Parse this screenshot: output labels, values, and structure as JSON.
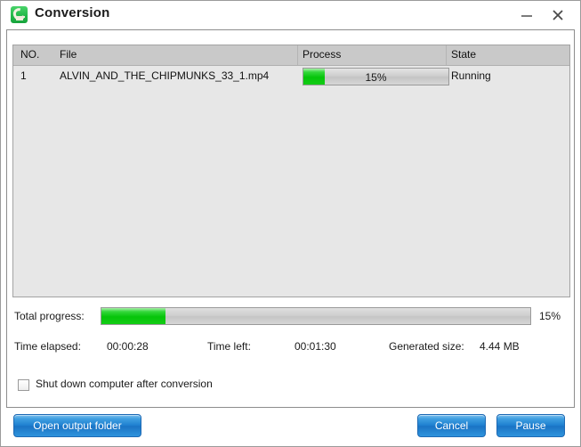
{
  "window": {
    "title": "Conversion",
    "icon": "app-logo-icon",
    "minimize_label": "minimize-icon",
    "close_label": "close-icon"
  },
  "list": {
    "columns": [
      "NO.",
      "File",
      "Process",
      "State"
    ],
    "rows": [
      {
        "no": "1",
        "file": "ALVIN_AND_THE_CHIPMUNKS_33_1.mp4",
        "progress_percent": 15,
        "progress_text": "15%",
        "state": "Running"
      }
    ]
  },
  "total": {
    "label": "Total progress:",
    "percent": 15,
    "percent_text": "15%"
  },
  "stats": {
    "time_elapsed_label": "Time elapsed:",
    "time_elapsed_value": "00:00:28",
    "time_left_label": "Time left:",
    "time_left_value": "00:01:30",
    "generated_size_label": "Generated size:",
    "generated_size_value": "4.44 MB"
  },
  "options": {
    "shutdown_label": "Shut down computer after conversion",
    "shutdown_checked": false
  },
  "footer": {
    "open_output_folder": "Open output folder",
    "cancel": "Cancel",
    "pause": "Pause"
  },
  "colors": {
    "accent_blue": "#1e7fd0",
    "progress_green": "#06c40a",
    "header_gray": "#c9c9c9",
    "list_bg": "#e7e7e7"
  }
}
